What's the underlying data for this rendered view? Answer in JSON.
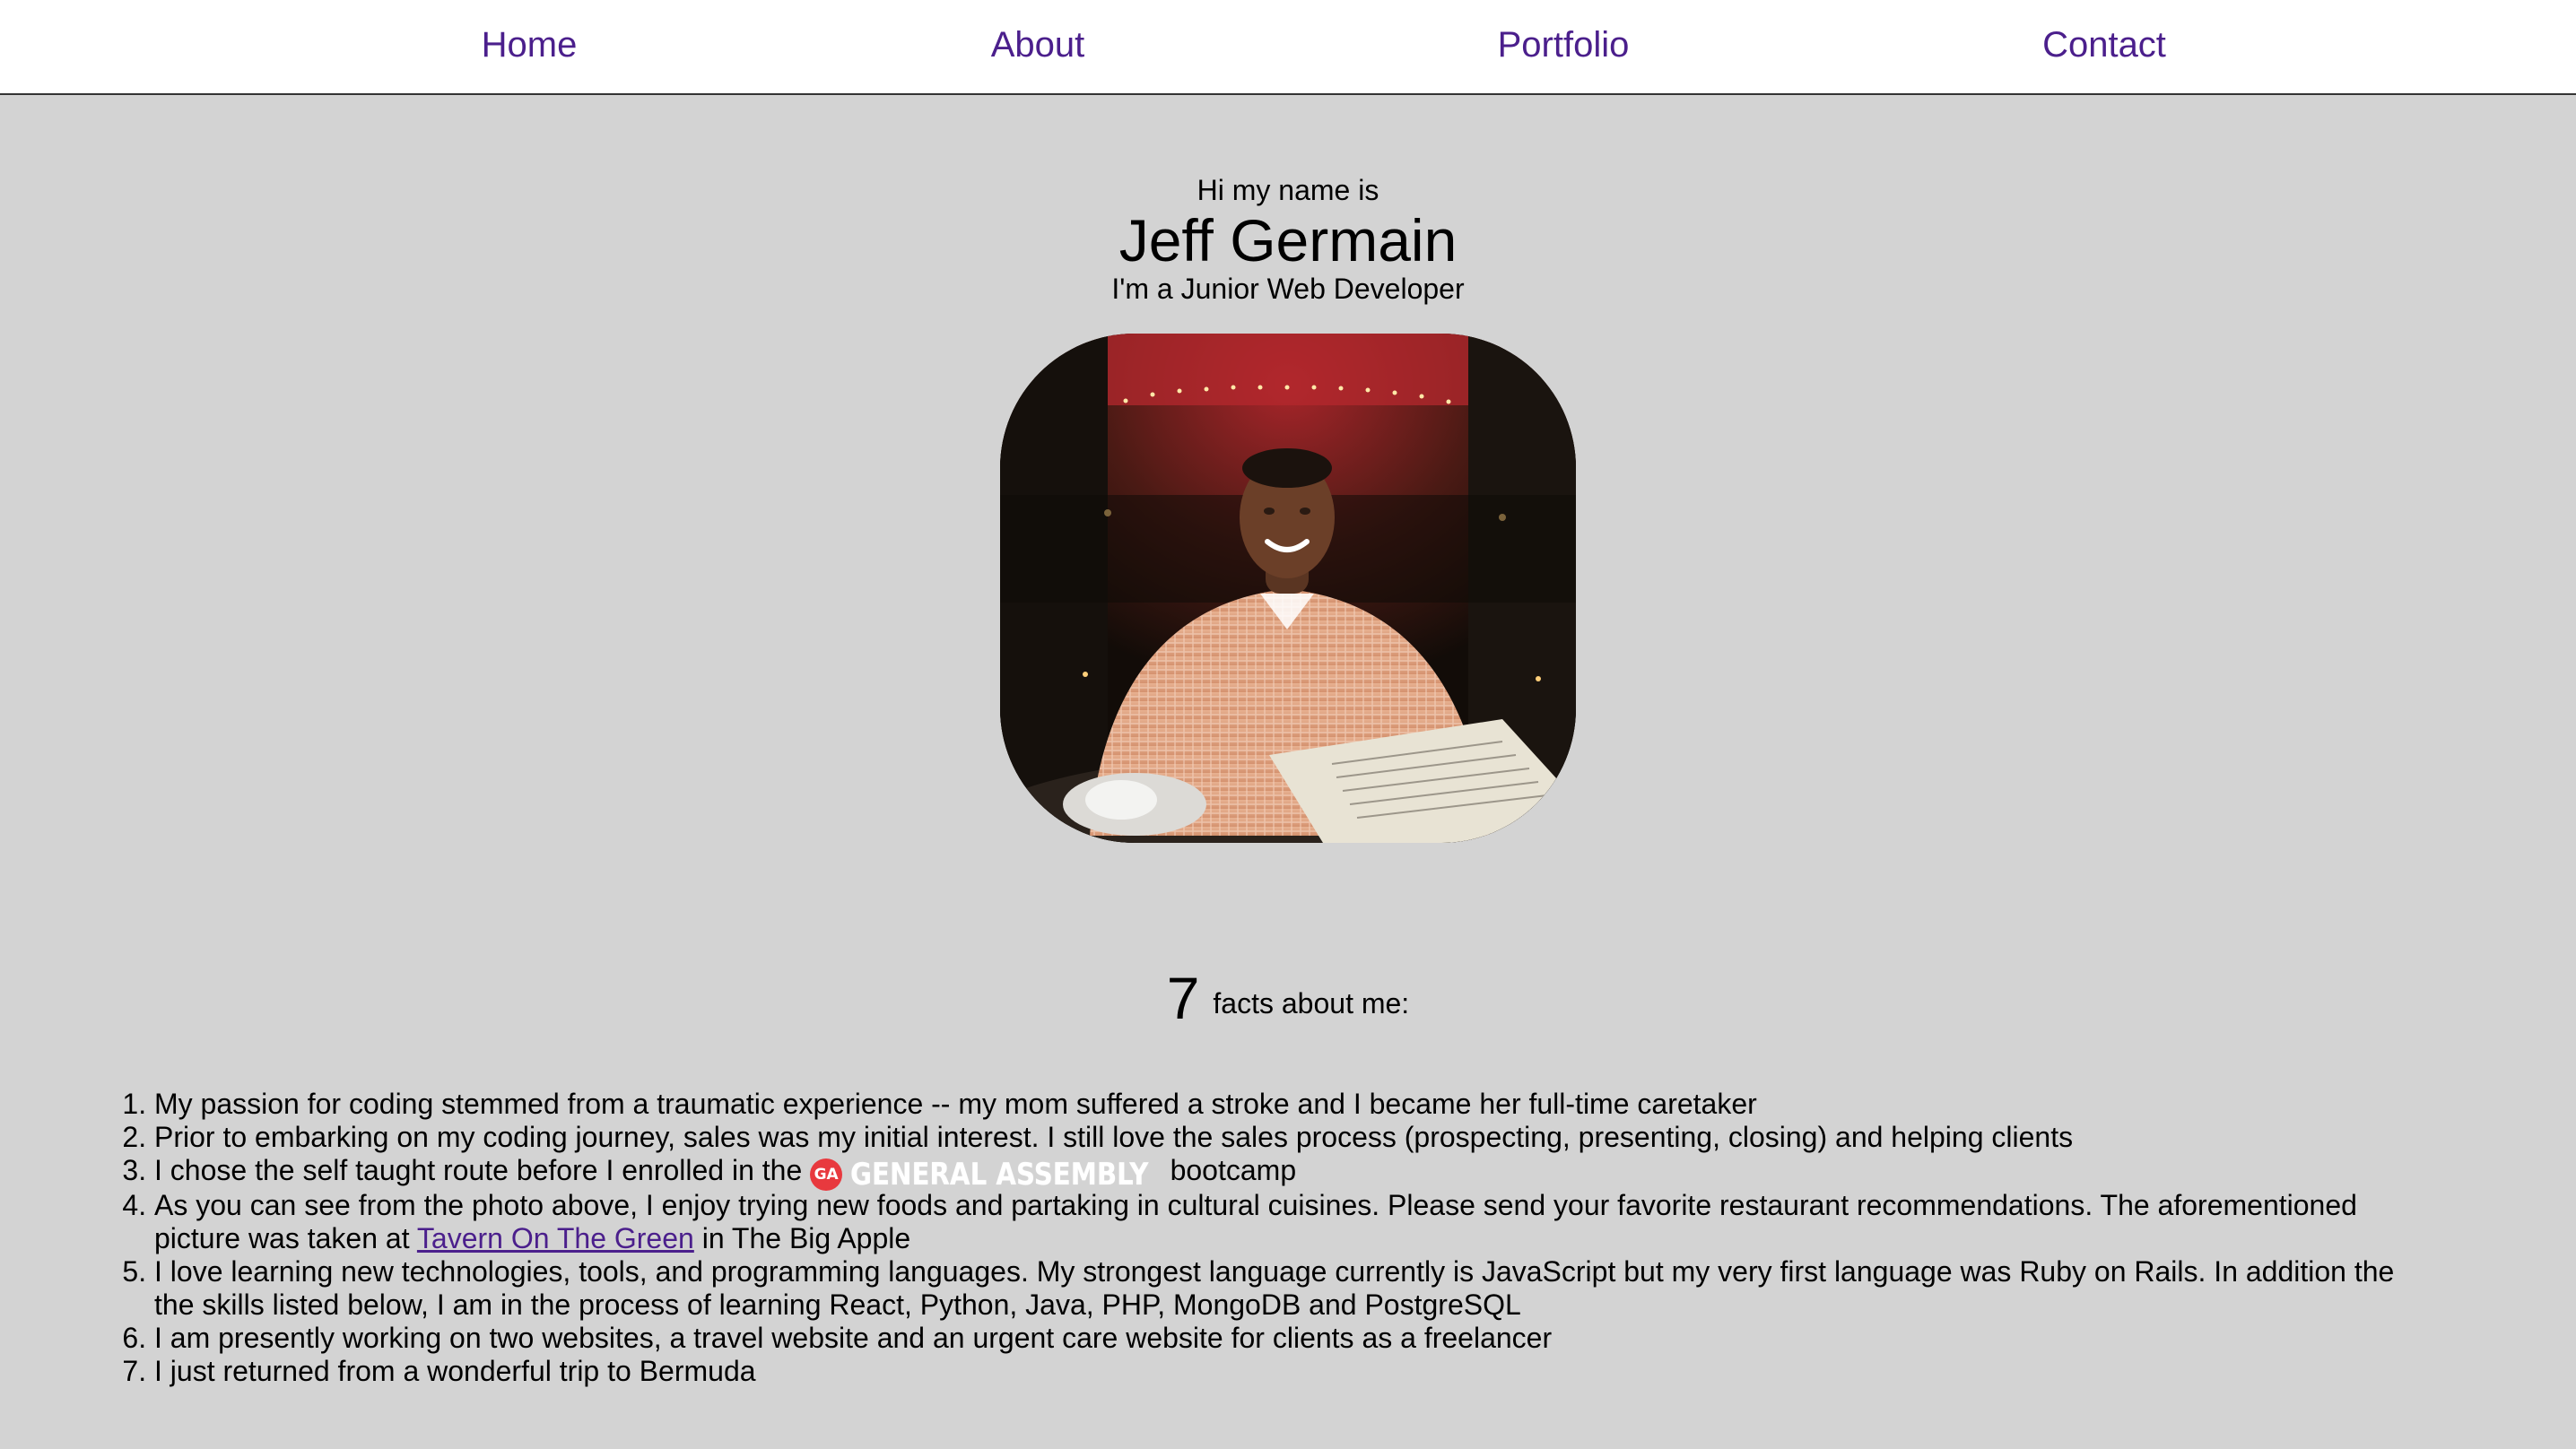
{
  "nav": {
    "items": [
      {
        "label": "Home"
      },
      {
        "label": "About"
      },
      {
        "label": "Portfolio"
      },
      {
        "label": "Contact"
      }
    ]
  },
  "intro": {
    "greeting": "Hi my name is",
    "name": "Jeff Germain",
    "subtitle": "I'm a Junior Web Developer"
  },
  "facts": {
    "count": "7",
    "heading": "facts about me:",
    "items": [
      {
        "text": "My passion for coding stemmed from a traumatic experience -- my mom suffered a stroke and I became her full-time caretaker"
      },
      {
        "text": "Prior to embarking on my coding journey, sales was my initial interest. I still love the sales process (prospecting, presenting, closing) and helping clients"
      },
      {
        "before": "I chose the self taught route before I enrolled in the ",
        "logo_badge": "GA",
        "logo_text": "GENERAL ASSEMBLY",
        "after": "bootcamp"
      },
      {
        "before": "As you can see from the photo above, I enjoy trying new foods and partaking in cultural cuisines. Please send your favorite restaurant recommendations. The aforementioned picture was taken at ",
        "link": "Tavern On The Green",
        "after": " in The Big Apple"
      },
      {
        "text": "I love learning new technologies, tools, and programming languages. My strongest language currently is JavaScript but my very first language was Ruby on Rails. In addition the the skills listed below, I am in the process of learning React, Python, Java, PHP, MongoDB and PostgreSQL"
      },
      {
        "text": "I am presently working on two websites, a travel website and an urgent care website for clients as a freelancer"
      },
      {
        "text": "I just returned from a wonderful trip to Bermuda"
      }
    ]
  },
  "colors": {
    "page_background": "#d3d3d3",
    "nav_background": "#ffffff",
    "link": "#4b1f8c",
    "ga_red": "#e8393e"
  }
}
